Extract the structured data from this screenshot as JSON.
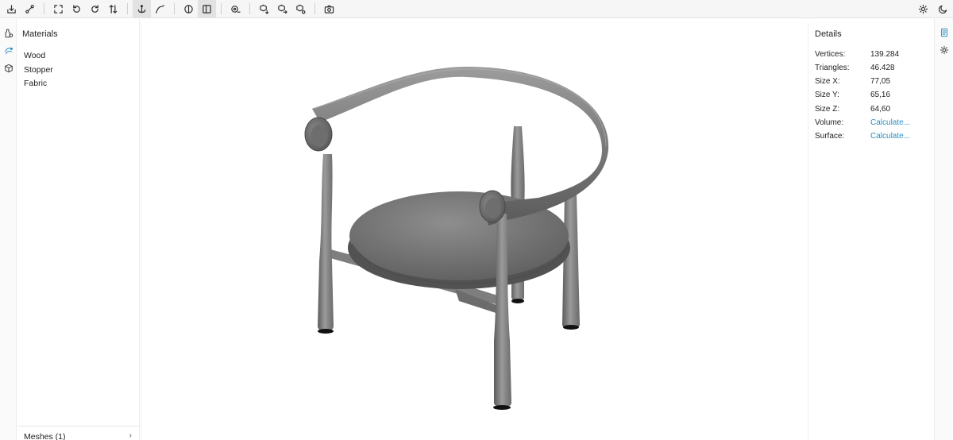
{
  "toolbar": {
    "left_groups": [
      [
        "import-icon",
        "path-icon"
      ],
      [
        "fit-view-icon",
        "rotate-left-icon",
        "rotate-right-icon",
        "flip-axis-icon"
      ],
      [
        "anchor-icon",
        "draw-curve-icon"
      ],
      [
        "contrast-icon",
        "panel-icon"
      ],
      [
        "measure-icon"
      ],
      [
        "cube-down-icon",
        "cube-right-icon",
        "cube-settings-icon"
      ],
      [
        "camera-icon"
      ]
    ],
    "right_icons": [
      "sun-icon",
      "moon-icon"
    ]
  },
  "left_strip": {
    "icons": [
      "bottle-icon",
      "materials-icon",
      "cube-icon"
    ],
    "active": "materials-icon"
  },
  "materials": {
    "title": "Materials",
    "items": [
      "Wood",
      "Stopper",
      "Fabric"
    ],
    "meshes_label": "Meshes (1)",
    "meshes_chevron": "›"
  },
  "details": {
    "title": "Details",
    "rows": [
      {
        "label": "Vertices:",
        "value": "139.284",
        "link": false
      },
      {
        "label": "Triangles:",
        "value": "46.428",
        "link": false
      },
      {
        "label": "Size X:",
        "value": "77,05",
        "link": false
      },
      {
        "label": "Size Y:",
        "value": "65,16",
        "link": false
      },
      {
        "label": "Size Z:",
        "value": "64,60",
        "link": false
      },
      {
        "label": "Volume:",
        "value": "Calculate...",
        "link": true
      },
      {
        "label": "Surface:",
        "value": "Calculate...",
        "link": true
      }
    ]
  },
  "right_strip": {
    "icons": [
      "details-doc-icon",
      "settings-gear-icon"
    ],
    "active": "details-doc-icon"
  },
  "colors": {
    "accent": "#2c8fc4",
    "model_grey": "#7d7d7d"
  }
}
